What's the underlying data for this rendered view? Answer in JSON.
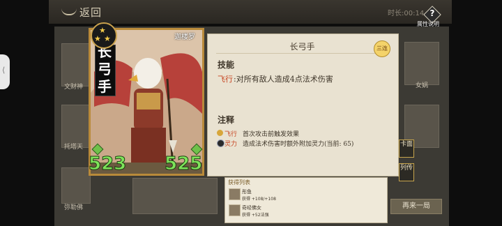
{
  "top_bar": {
    "back_label": "返回",
    "timer_label": "时长:00:14",
    "help_label": "属性说明",
    "help_glyph": "?"
  },
  "background_cards": [
    {
      "label": "文财神"
    },
    {
      "label": "托塔天"
    },
    {
      "label": "弥勒佛"
    },
    {
      "label": "女娲"
    }
  ],
  "replay_button": {
    "label": "再来一局"
  },
  "hero": {
    "name": "长弓手",
    "rank_label": "迦楼罗",
    "stars": 3,
    "attack": "523",
    "health": "525"
  },
  "panel": {
    "title": "长弓手",
    "badge": "三连",
    "skills_heading": "技能",
    "skill": {
      "name": "飞行",
      "desc": ":对所有敌人造成4点法术伤害"
    },
    "notes_heading": "注释",
    "notes": [
      {
        "name": "飞行",
        "desc": "首次攻击前触发效果",
        "icon_color": "#d7a63a"
      },
      {
        "name": "灵力",
        "desc": "造成法术伤害时额外附加灵力(当前: 65)",
        "icon_color": "#2a2a2a"
      }
    ]
  },
  "side_buttons": [
    {
      "label": "卡面"
    },
    {
      "label": "列传"
    }
  ],
  "reward_list": {
    "title": "获得列表",
    "rows": [
      {
        "name": "彤鱼",
        "gain": "获得 +108/+108"
      },
      {
        "name": "奇经佛女",
        "gain": "获得 +52法强"
      }
    ]
  },
  "colors": {
    "accent_green": "#7ee35a",
    "skill_red": "#c6421f",
    "card_gold": "#b98a3a"
  }
}
